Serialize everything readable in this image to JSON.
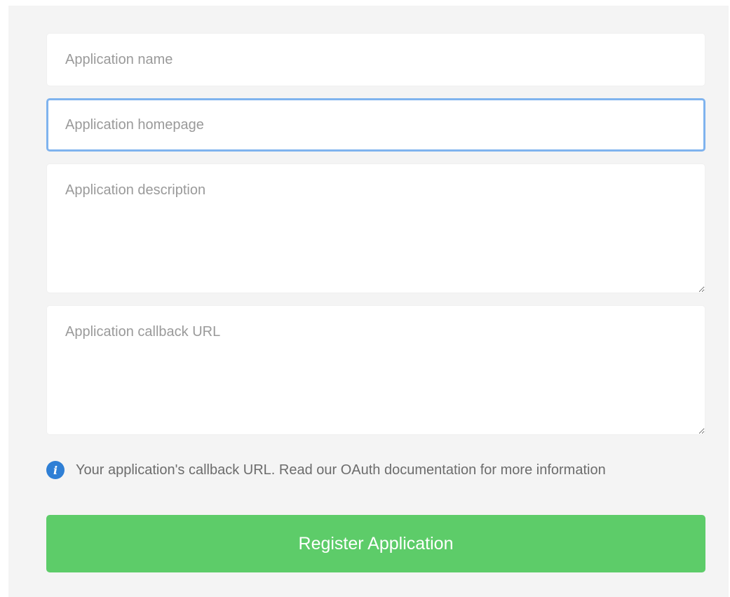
{
  "form": {
    "name_field": {
      "placeholder": "Application name",
      "value": ""
    },
    "homepage_field": {
      "placeholder": "Application homepage",
      "value": ""
    },
    "description_field": {
      "placeholder": "Application description",
      "value": ""
    },
    "callback_field": {
      "placeholder": "Application callback URL",
      "value": ""
    },
    "help_text": "Your application's callback URL. Read our OAuth documentation for more information",
    "info_icon": "info-icon",
    "submit_label": "Register Application"
  },
  "colors": {
    "panel_background": "#f4f4f4",
    "focus_border": "#7fb3ee",
    "info_icon": "#2f7fd5",
    "submit_button": "#5dcc69"
  }
}
